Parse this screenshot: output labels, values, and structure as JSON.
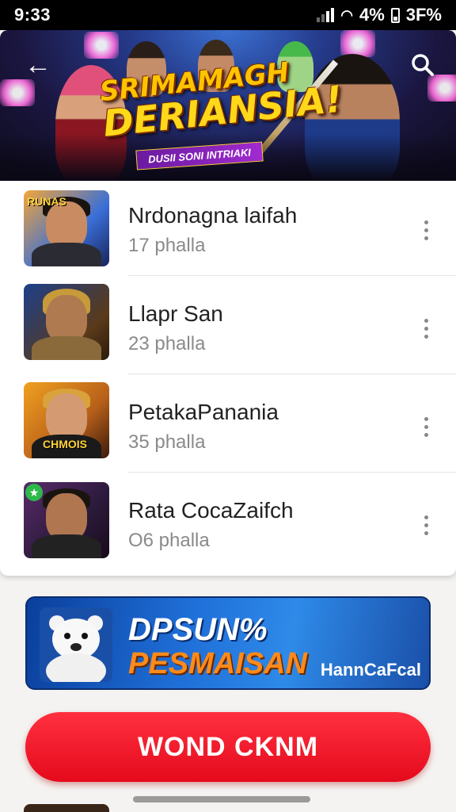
{
  "status_bar": {
    "time": "9:33",
    "battery_percent": "4%",
    "temperature": "3F%"
  },
  "banner": {
    "title_line1": "SRIMAMAGH",
    "title_line2": "DERIANSIA!",
    "subtitle": "DUSII SONI INTRIAKI",
    "back_icon": "back-arrow-icon",
    "search_icon": "search-icon"
  },
  "list": [
    {
      "name": "Nrdonagna laifah",
      "subtitle": "17 phalla",
      "thumb_tag": "RUNAS"
    },
    {
      "name": "Llapr San",
      "subtitle": "23 phalla",
      "thumb_tag": ""
    },
    {
      "name": "PetakaPanania",
      "subtitle": "35 phalla",
      "thumb_tag": "CHMOIS"
    },
    {
      "name": "Rata CocaZaifch",
      "subtitle": "O6 phalla",
      "thumb_tag": ""
    }
  ],
  "ad": {
    "line1": "DPSUN%",
    "line2": "PESMAISAN",
    "brand": "HannCaFcal"
  },
  "cta": {
    "label": "WOND CKNM"
  },
  "colors": {
    "accent": "#e40a1c",
    "ad_blue": "#1f6fd8",
    "title_gold": "#ffc400"
  }
}
